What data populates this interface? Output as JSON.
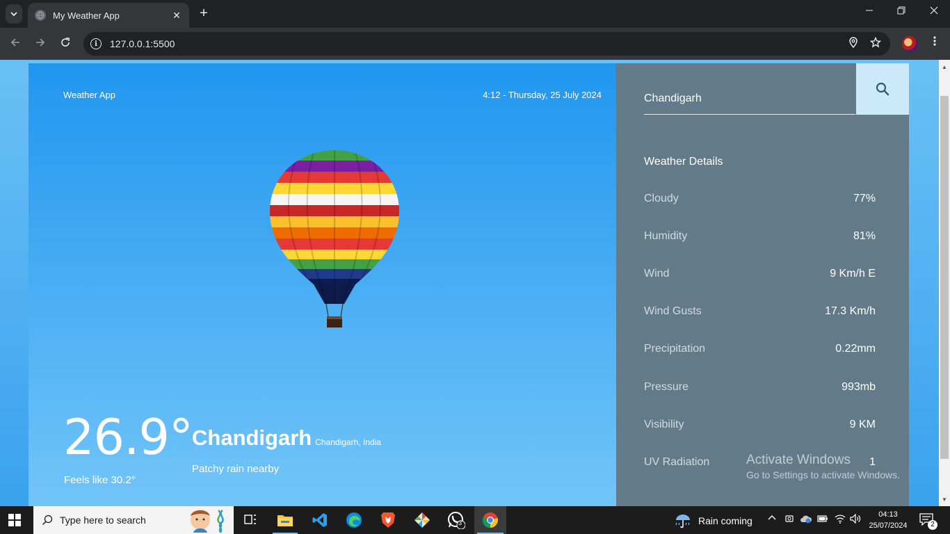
{
  "browser": {
    "tab_title": "My Weather App",
    "url": "127.0.0.1:5500",
    "new_tab_glyph": "+",
    "tab_close_glyph": "✕"
  },
  "app": {
    "brand": "Weather App",
    "datetime": "4:12 - Thursday, 25 July 2024",
    "temperature": "26.9°",
    "feels_like": "Feels like 30.2°",
    "city": "Chandigarh",
    "region": "Chandigarh, India",
    "condition": "Patchy rain nearby",
    "search_value": "Chandigarh",
    "details_title": "Weather Details",
    "details": [
      {
        "label": "Cloudy",
        "value": "77%"
      },
      {
        "label": "Humidity",
        "value": "81%"
      },
      {
        "label": "Wind",
        "value": "9 Km/h E"
      },
      {
        "label": "Wind Gusts",
        "value": "17.3 Km/h"
      },
      {
        "label": "Precipitation",
        "value": "0.22mm"
      },
      {
        "label": "Pressure",
        "value": "993mb"
      },
      {
        "label": "Visibility",
        "value": "9 KM"
      },
      {
        "label": "UV Radiation",
        "value": "1"
      }
    ]
  },
  "watermark": {
    "title": "Activate Windows",
    "subtitle": "Go to Settings to activate Windows."
  },
  "taskbar": {
    "search_placeholder": "Type here to search",
    "weather_status": "Rain coming",
    "time": "04:13",
    "date": "25/07/2024",
    "notification_count": "2",
    "whatsapp_badge": "3"
  },
  "colors": {
    "panel_left_top": "#2196f0",
    "panel_right": "#637b89",
    "search_button": "#cce9f9"
  }
}
